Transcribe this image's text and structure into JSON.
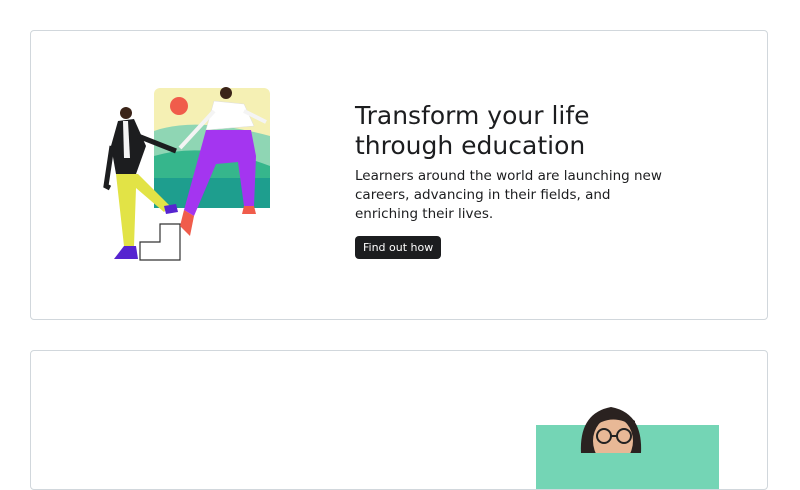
{
  "hero": {
    "headline": "Transform your life through education",
    "subtext": "Learners around the world are launching new careers, advancing in their fields, and enriching their lives.",
    "cta_label": "Find out how"
  },
  "colors": {
    "card_border": "#d1d7dc",
    "button_bg": "#1c1d1f",
    "mint": "#74d5b5",
    "sun": "#f05c4b",
    "sky": "#f5f0b4",
    "hills": "#36b68c",
    "purple": "#a435f0",
    "yellow_pants": "#e2e346",
    "shoe_purple": "#5624d0"
  },
  "icons": {
    "hero_illustration": "people-climbing-stairs-illustration",
    "second_card_photo": "woman-with-glasses-photo"
  }
}
